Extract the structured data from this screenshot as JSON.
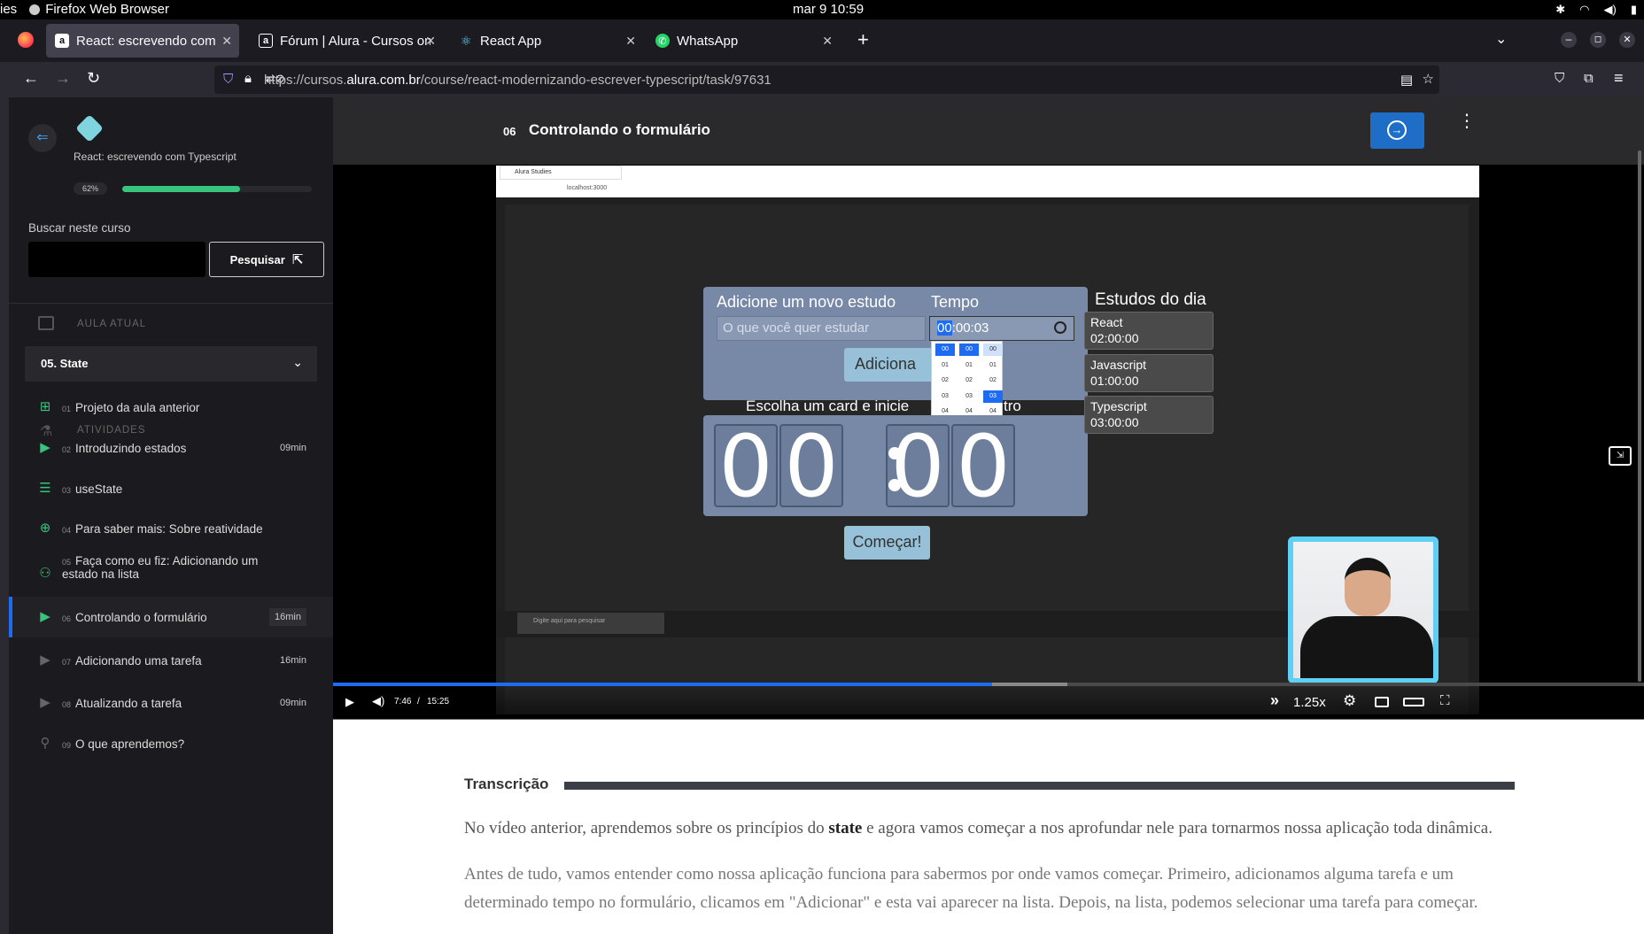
{
  "os": {
    "activities": "ies",
    "app_name": "Firefox Web Browser",
    "clock": "mar 9  10:59"
  },
  "tabs": [
    {
      "title": "React: escrevendo com T",
      "fav": "a",
      "favcolor": "#0d0d0d"
    },
    {
      "title": "Fórum | Alura - Cursos on",
      "fav": "a",
      "favcolor": "#0d0d0d"
    },
    {
      "title": "React App",
      "fav": "⚛",
      "favcolor": "#1c1b22"
    },
    {
      "title": "WhatsApp",
      "fav": "✆",
      "favcolor": "#25d366"
    }
  ],
  "url": {
    "prefix": "https://cursos.",
    "domain": "alura.com.br",
    "path": "/course/react-modernizando-escrever-typescript/task/97631"
  },
  "sidebar": {
    "course_title": "React: escrevendo com Typescript",
    "progress_label": "62%",
    "progress": 0.62,
    "search_label": "Buscar neste curso",
    "search_placeholder": "",
    "search_button": "Pesquisar",
    "current_section_label": "AULA ATUAL",
    "current_lesson": "05. State",
    "activities_label": "ATIVIDADES",
    "activities": [
      {
        "num": "01",
        "title": "Projeto da aula anterior",
        "title2": "",
        "dur": "",
        "icon": "book"
      },
      {
        "num": "02",
        "title": "Introduzindo estados",
        "title2": "",
        "dur": "09min",
        "icon": "play"
      },
      {
        "num": "03",
        "title": "useState",
        "title2": "",
        "dur": "",
        "icon": "list"
      },
      {
        "num": "04",
        "title": "Para saber mais: Sobre reatividade",
        "title2": "",
        "dur": "",
        "icon": "plus"
      },
      {
        "num": "05",
        "title": "Faça como eu fiz: Adicionando um",
        "title2": "estado na lista",
        "dur": "",
        "icon": "people"
      },
      {
        "num": "06",
        "title": "Controlando o formulário",
        "title2": "",
        "dur": "16min",
        "icon": "play"
      },
      {
        "num": "07",
        "title": "Adicionando uma tarefa",
        "title2": "",
        "dur": "16min",
        "icon": "play"
      },
      {
        "num": "08",
        "title": "Atualizando a tarefa",
        "title2": "",
        "dur": "09min",
        "icon": "play"
      },
      {
        "num": "09",
        "title": "O que aprendemos?",
        "title2": "",
        "dur": "",
        "icon": "person"
      }
    ]
  },
  "lesson": {
    "num": "06",
    "title": "Controlando o formulário"
  },
  "video": {
    "current": "7:46",
    "separator": "/",
    "total": "15:25",
    "progress": 0.503,
    "buffered": 0.56,
    "speed": "1.25x",
    "nested": {
      "tab_title": "Alura Studies",
      "address": "localhost:3000",
      "form_title": "Adicione um novo estudo",
      "time_label": "Tempo",
      "input_placeholder": "O que você quer estudar",
      "time_value_hl": "00",
      "time_value_rest": ":00:03",
      "add_button": "Adiciona",
      "cards_heading": "Escolha um card e inicie",
      "cards_heading_tail": "tro",
      "clock_digits": [
        "0",
        "0",
        "0",
        "0"
      ],
      "start_button": "Começar!",
      "day_heading": "Estudos do dia",
      "day_items": [
        {
          "name": "React",
          "time": "02:00:00"
        },
        {
          "name": "Javascript",
          "time": "01:00:00"
        },
        {
          "name": "Typescript",
          "time": "03:00:00"
        }
      ],
      "picker_rows": [
        "00",
        "01",
        "02",
        "03",
        "04",
        "05",
        "06"
      ],
      "taskbar_search": "Digite aqui para pesquisar"
    }
  },
  "transcript": {
    "heading": "Transcrição",
    "p1_a": "No vídeo anterior, aprendemos sobre os princípios do ",
    "p1_b": "state",
    "p1_c": " e agora vamos começar a nos aprofundar nele para tornarmos nossa aplicação toda dinâmica.",
    "p2": "Antes de tudo, vamos entender como nossa aplicação funciona para sabermos por onde vamos começar. Primeiro, adicionamos alguma tarefa e um determinado tempo no formulário, clicamos em \"Adicionar\" e esta vai aparecer na lista. Depois, na lista, podemos selecionar uma tarefa para começar."
  },
  "colors": {
    "accent": "#1e6ec8",
    "green": "#37c47c",
    "progress_blue": "#1d6cf2"
  }
}
